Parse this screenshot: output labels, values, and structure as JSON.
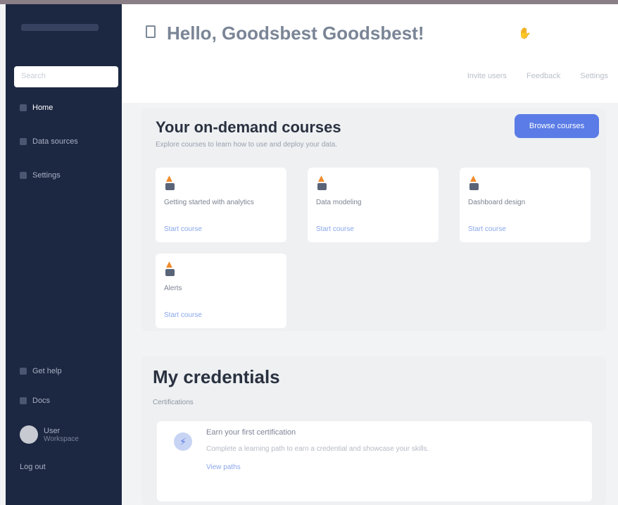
{
  "sidebar": {
    "search_placeholder": "Search",
    "items": [
      {
        "label": "Home"
      },
      {
        "label": "Data sources"
      },
      {
        "label": "Settings"
      }
    ],
    "bottom_items": [
      {
        "label": "Get help"
      },
      {
        "label": "Docs"
      }
    ],
    "user": {
      "name": "User",
      "org": "Workspace"
    },
    "footer": "Log out"
  },
  "header": {
    "title": "Hello, Goodsbest Goodsbest!",
    "wave_icon": "wave-icon",
    "links": [
      "Invite users",
      "Feedback",
      "Settings"
    ]
  },
  "on_demand": {
    "title": "Your on-demand courses",
    "subtitle": "Explore courses to learn how to use and deploy your data.",
    "button_label": "Browse courses",
    "courses": [
      {
        "name": "Getting started with analytics",
        "link": "Start course"
      },
      {
        "name": "Data modeling",
        "link": "Start course"
      },
      {
        "name": "Dashboard design",
        "link": "Start course"
      },
      {
        "name": "Alerts",
        "link": "Start course"
      }
    ]
  },
  "credentials": {
    "title": "My credentials",
    "subtitle": "Certifications",
    "card": {
      "title": "Earn your first certification",
      "description": "Complete a learning path to earn a credential and showcase your skills.",
      "link": "View paths"
    }
  },
  "colors": {
    "sidebar_bg": "#1c2742",
    "accent": "#5b7ce6",
    "icon_orange": "#f08b2c"
  }
}
